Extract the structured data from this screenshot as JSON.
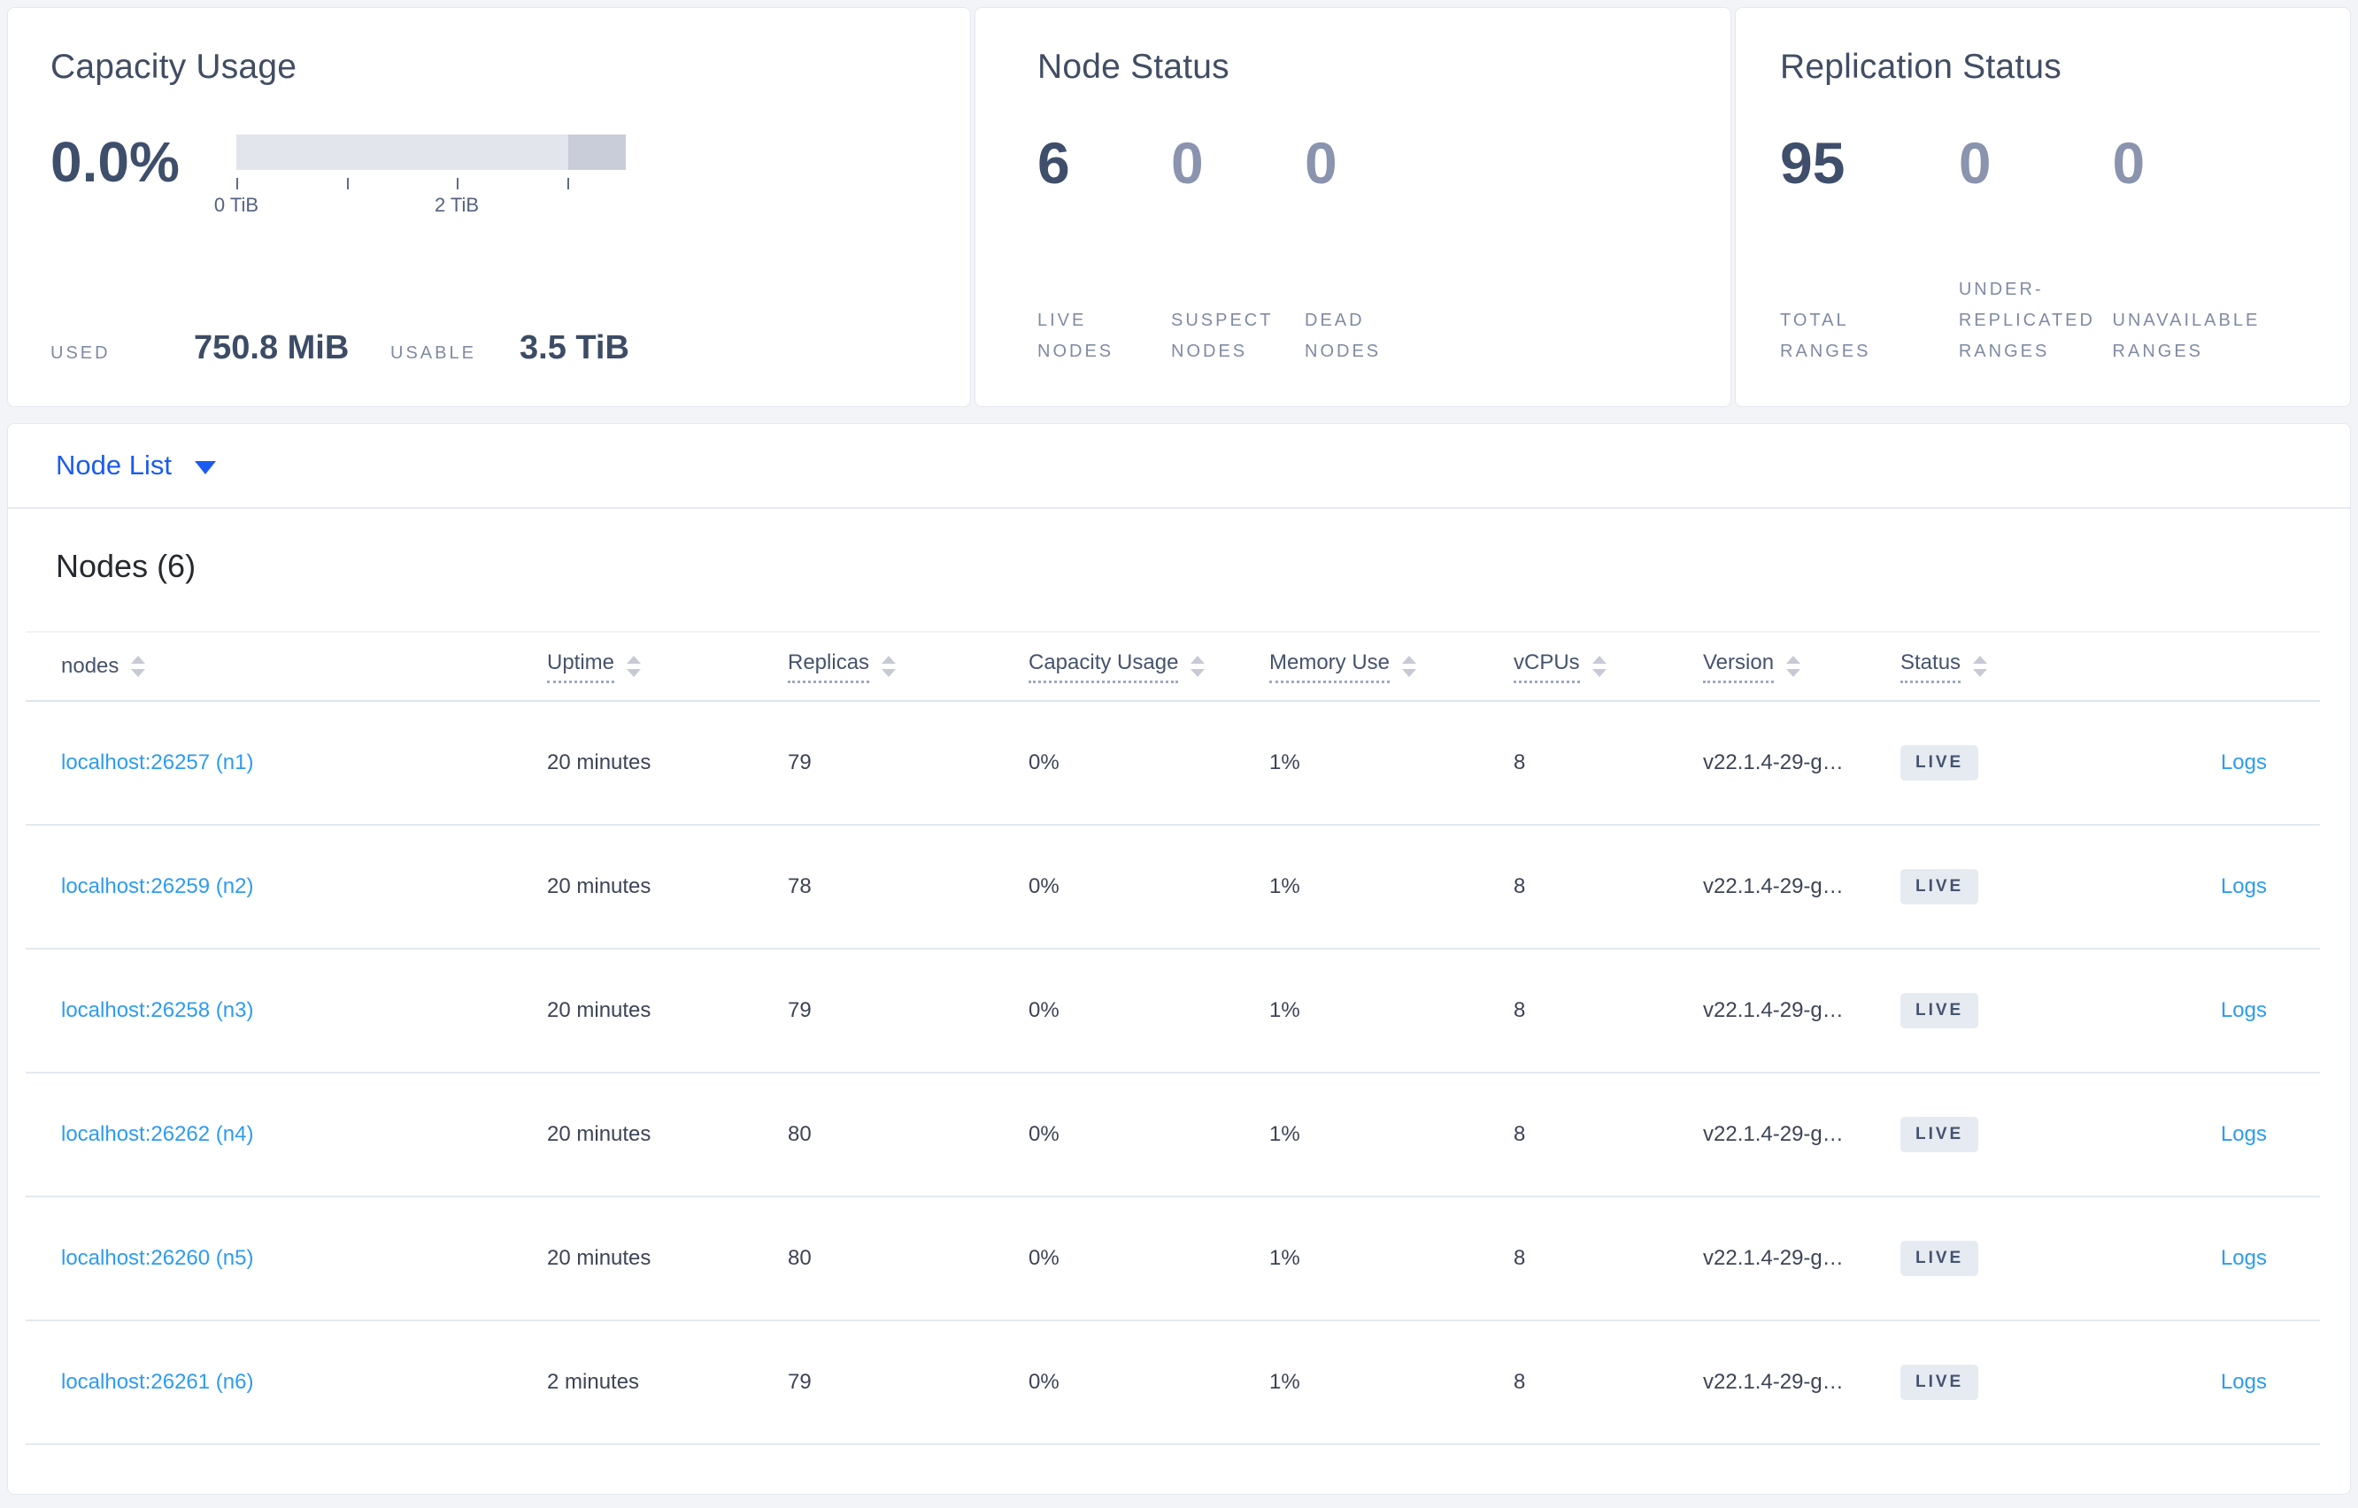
{
  "colors": {
    "accent_link": "#1a5cf2",
    "table_link": "#2d9bf2",
    "stat_dark": "#3e4e6b",
    "stat_muted": "#8a94ae",
    "badge_bg": "#e6eaf1",
    "badge_text": "#44536f"
  },
  "capacity_usage": {
    "title": "Capacity Usage",
    "percent": "0.0%",
    "bar": {
      "dark_segment_start_fraction": 0.853,
      "ticks": [
        {
          "label": "0 TiB",
          "frac": 0.0
        },
        {
          "label": "",
          "frac": 0.283
        },
        {
          "label": "2 TiB",
          "frac": 0.566
        },
        {
          "label": "",
          "frac": 0.849
        }
      ]
    },
    "used_label": "USED",
    "used_value": "750.8 MiB",
    "usable_label": "USABLE",
    "usable_value": "3.5 TiB"
  },
  "node_status": {
    "title": "Node Status",
    "stats": [
      {
        "value": "6",
        "label": "LIVE NODES",
        "muted": false
      },
      {
        "value": "0",
        "label": "SUSPECT NODES",
        "muted": true
      },
      {
        "value": "0",
        "label": "DEAD NODES",
        "muted": true
      }
    ]
  },
  "replication_status": {
    "title": "Replication Status",
    "stats": [
      {
        "value": "95",
        "label": "TOTAL RANGES",
        "muted": false
      },
      {
        "value": "0",
        "label": "UNDER-REPLICATED RANGES",
        "muted": true
      },
      {
        "value": "0",
        "label": "UNAVAILABLE RANGES",
        "muted": true
      }
    ]
  },
  "view_selector": {
    "label": "Node List",
    "icon": "chevron-down"
  },
  "nodes_table": {
    "title": "Nodes (6)",
    "columns": [
      {
        "label": "nodes",
        "sortable": true,
        "tooltip": false
      },
      {
        "label": "Uptime",
        "sortable": true,
        "tooltip": true
      },
      {
        "label": "Replicas",
        "sortable": true,
        "tooltip": true
      },
      {
        "label": "Capacity Usage",
        "sortable": true,
        "tooltip": true
      },
      {
        "label": "Memory Use",
        "sortable": true,
        "tooltip": true
      },
      {
        "label": "vCPUs",
        "sortable": true,
        "tooltip": true
      },
      {
        "label": "Version",
        "sortable": true,
        "tooltip": true
      },
      {
        "label": "Status",
        "sortable": true,
        "tooltip": true
      },
      {
        "label": "",
        "sortable": false,
        "tooltip": false
      }
    ],
    "rows": [
      {
        "node": "localhost:26257 (n1)",
        "uptime": "20 minutes",
        "replicas": "79",
        "capacity_usage": "0%",
        "memory_use": "1%",
        "vcpus": "8",
        "version": "v22.1.4-29-g…",
        "status": "LIVE",
        "logs": "Logs"
      },
      {
        "node": "localhost:26259 (n2)",
        "uptime": "20 minutes",
        "replicas": "78",
        "capacity_usage": "0%",
        "memory_use": "1%",
        "vcpus": "8",
        "version": "v22.1.4-29-g…",
        "status": "LIVE",
        "logs": "Logs"
      },
      {
        "node": "localhost:26258 (n3)",
        "uptime": "20 minutes",
        "replicas": "79",
        "capacity_usage": "0%",
        "memory_use": "1%",
        "vcpus": "8",
        "version": "v22.1.4-29-g…",
        "status": "LIVE",
        "logs": "Logs"
      },
      {
        "node": "localhost:26262 (n4)",
        "uptime": "20 minutes",
        "replicas": "80",
        "capacity_usage": "0%",
        "memory_use": "1%",
        "vcpus": "8",
        "version": "v22.1.4-29-g…",
        "status": "LIVE",
        "logs": "Logs"
      },
      {
        "node": "localhost:26260 (n5)",
        "uptime": "20 minutes",
        "replicas": "80",
        "capacity_usage": "0%",
        "memory_use": "1%",
        "vcpus": "8",
        "version": "v22.1.4-29-g…",
        "status": "LIVE",
        "logs": "Logs"
      },
      {
        "node": "localhost:26261 (n6)",
        "uptime": "2 minutes",
        "replicas": "79",
        "capacity_usage": "0%",
        "memory_use": "1%",
        "vcpus": "8",
        "version": "v22.1.4-29-g…",
        "status": "LIVE",
        "logs": "Logs"
      }
    ]
  }
}
